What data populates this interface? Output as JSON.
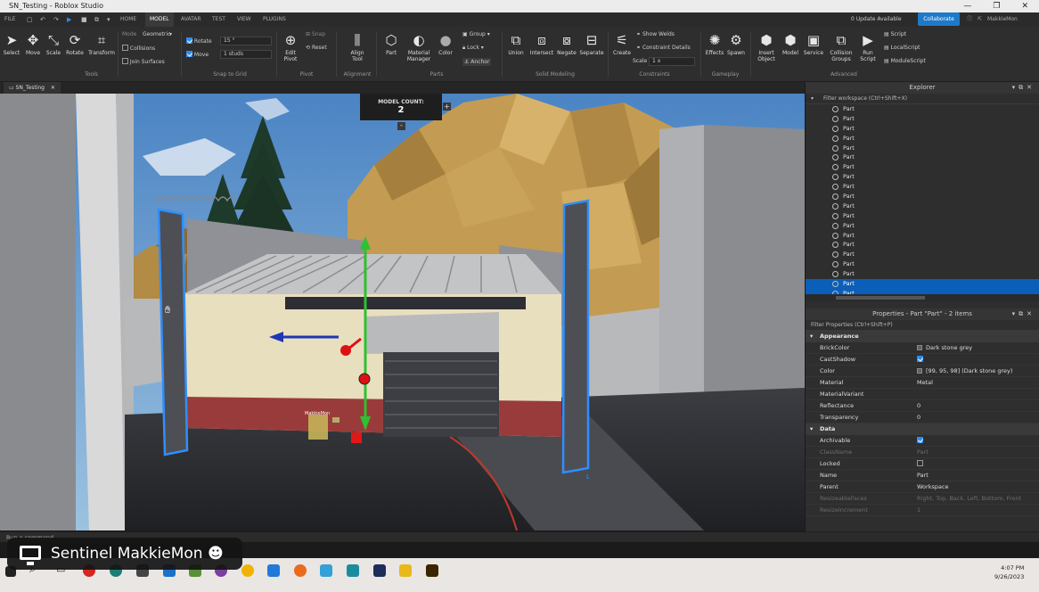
{
  "window": {
    "title": "SN_Testing - Roblox Studio"
  },
  "menu": {
    "file": "FILE",
    "tabs": [
      "HOME",
      "MODEL",
      "AVATAR",
      "TEST",
      "VIEW",
      "PLUGINS"
    ],
    "update_notice": "0 Update Available",
    "collaborate": "Collaborate",
    "user": "MakkieMon"
  },
  "ribbon": {
    "tools": {
      "select": "Select",
      "move": "Move",
      "scale": "Scale",
      "rotate": "Rotate",
      "transform": "Transform",
      "group_label": "Tools"
    },
    "mode": {
      "label": "Mode",
      "value": "Geometric",
      "collisions": "Collisions",
      "join_surfaces": "Join Surfaces"
    },
    "snap": {
      "rotate": "Rotate",
      "rotate_value": "15 °",
      "move": "Move",
      "move_value": "1 studs",
      "group_label": "Snap to Grid"
    },
    "pivot": {
      "edit": "Edit\nPivot",
      "snap": "Snap",
      "reset": "Reset",
      "group_label": "Pivot"
    },
    "alignment": {
      "align": "Align\nTool",
      "group_label": "Alignment"
    },
    "parts": {
      "part": "Part",
      "material": "Material\nManager",
      "color": "Color",
      "group": "Group",
      "lock": "Lock",
      "anchor": "Anchor",
      "group_label": "Parts"
    },
    "solid": {
      "union": "Union",
      "intersect": "Intersect",
      "negate": "Negate",
      "separate": "Separate",
      "group_label": "Solid Modeling"
    },
    "constraints": {
      "create": "Create",
      "show_welds": "Show Welds",
      "constraint_details": "Constraint Details",
      "scale": "Scale",
      "scale_value": "1 x",
      "group_label": "Constraints"
    },
    "gameplay": {
      "effects": "Effects",
      "spawn": "Spawn",
      "group_label": "Gameplay"
    },
    "advanced": {
      "insert_object": "Insert\nObject",
      "model": "Model",
      "service": "Service",
      "collision_groups": "Collision\nGroups",
      "run_script": "Run\nScript",
      "script": "Script",
      "local_script": "LocalScript",
      "module_script": "ModuleScript",
      "group_label": "Advanced"
    }
  },
  "doc_tab": {
    "label": "SN_Testing"
  },
  "viewport": {
    "model_count_label": "MODEL COUNT:",
    "model_count": "2",
    "plus": "+",
    "minus": "-",
    "player_name": "MakkieMon",
    "axis_marker": "L"
  },
  "explorer": {
    "title": "Explorer",
    "filter": "Filter workspace (Ctrl+Shift+X)",
    "items": [
      "Part",
      "Part",
      "Part",
      "Part",
      "Part",
      "Part",
      "Part",
      "Part",
      "Part",
      "Part",
      "Part",
      "Part",
      "Part",
      "Part",
      "Part",
      "Part",
      "Part",
      "Part",
      "Part",
      "Part"
    ],
    "selected_indices": [
      18,
      19
    ]
  },
  "properties": {
    "title": "Properties - Part \"Part\" - 2 items",
    "filter": "Filter Properties (Ctrl+Shift+P)",
    "appearance_label": "Appearance",
    "brick_color_label": "BrickColor",
    "brick_color_value": "Dark stone grey",
    "cast_shadow_label": "CastShadow",
    "color_label": "Color",
    "color_value": "[99, 95, 98] (Dark stone grey)",
    "material_label": "Material",
    "material_value": "Metal",
    "material_variant_label": "MaterialVariant",
    "reflectance_label": "Reflectance",
    "reflectance_value": "0",
    "transparency_label": "Transparency",
    "transparency_value": "0",
    "data_label": "Data",
    "archivable_label": "Archivable",
    "classname_label": "ClassName",
    "classname_value": "Part",
    "locked_label": "Locked",
    "name_label": "Name",
    "name_value": "Part",
    "parent_label": "Parent",
    "parent_value": "Workspace",
    "resizeable_faces_label": "ResizeableFaces",
    "resizeable_faces_value": "Right, Top, Back, Left, Bottom, Front",
    "resize_increment_label": "ResizeIncrement",
    "resize_increment_value": "1"
  },
  "command_bar": {
    "placeholder": "Run a command"
  },
  "stream_overlay": {
    "text": "Sentinel MakkieMon"
  },
  "taskbar": {
    "time": "4:07 PM",
    "date": "9/26/2023"
  }
}
